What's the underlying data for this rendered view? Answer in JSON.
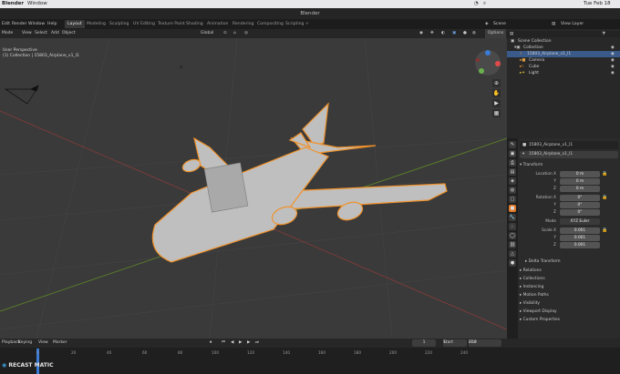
{
  "mac": {
    "app": "Blender",
    "window": "Window",
    "clock": "Tue Feb 18",
    "scene": "Scene",
    "view_layer": "View Layer"
  },
  "app": {
    "title": "Blender"
  },
  "menu": [
    "Edit",
    "Render",
    "Window",
    "Help"
  ],
  "workspaces": [
    {
      "label": "Layout",
      "active": true
    },
    {
      "label": "Modeling"
    },
    {
      "label": "Sculpting"
    },
    {
      "label": "UV Editing"
    },
    {
      "label": "Texture Paint"
    },
    {
      "label": "Shading"
    },
    {
      "label": "Animation"
    },
    {
      "label": "Rendering"
    },
    {
      "label": "Compositing"
    },
    {
      "label": "Scripting"
    },
    {
      "label": "+"
    }
  ],
  "viewport_header": {
    "mode": "Mode",
    "view": "View",
    "select": "Select",
    "add": "Add",
    "object": "Object",
    "orientation": "Global",
    "options": "Options"
  },
  "viewport": {
    "perspective": "User Perspective",
    "collection": "(1) Collection | 15803_Airplane_v1_l1"
  },
  "outliner": {
    "title": "Scene Collection",
    "collection": "Collection",
    "items": [
      {
        "label": "15803_Airplane_v1_l1",
        "selected": true
      },
      {
        "label": "Camera"
      },
      {
        "label": "Cube"
      },
      {
        "label": "Light"
      }
    ]
  },
  "properties": {
    "object_name": "15803_Airplane_v1_l1",
    "data_name": "15803_Airplane_v1_l1",
    "section_transform": "Transform",
    "location": {
      "label": "Location X",
      "x": "0 m",
      "y": "0 m",
      "z": "0 m"
    },
    "rotation": {
      "label": "Rotation X",
      "x": "0°",
      "y": "0°",
      "z": "0°"
    },
    "mode": {
      "label": "Mode",
      "value": "XYZ Euler"
    },
    "scale": {
      "label": "Scale X",
      "x": "0.001",
      "y": "0.001",
      "z": "0.001"
    },
    "axis_y": "Y",
    "axis_z": "Z",
    "sections": [
      "Delta Transform",
      "Relations",
      "Collections",
      "Instancing",
      "Motion Paths",
      "Visibility",
      "Viewport Display",
      "Custom Properties"
    ]
  },
  "timeline": {
    "playback": "Playback",
    "keying": "Keying",
    "view": "View",
    "marker": "Marker",
    "current_frame": "1",
    "start_label": "Start",
    "start": "1",
    "end_label": "End",
    "end": "250",
    "ticks": [
      "0",
      "20",
      "40",
      "60",
      "80",
      "100",
      "120",
      "140",
      "160",
      "180",
      "200",
      "220",
      "240"
    ]
  },
  "watermark": "RECAST MATIC",
  "colors": {
    "accent": "#f0922b",
    "viewport": "#3a3a3a",
    "panel": "#2b2b2b",
    "select_blue": "#3a5a8a"
  }
}
